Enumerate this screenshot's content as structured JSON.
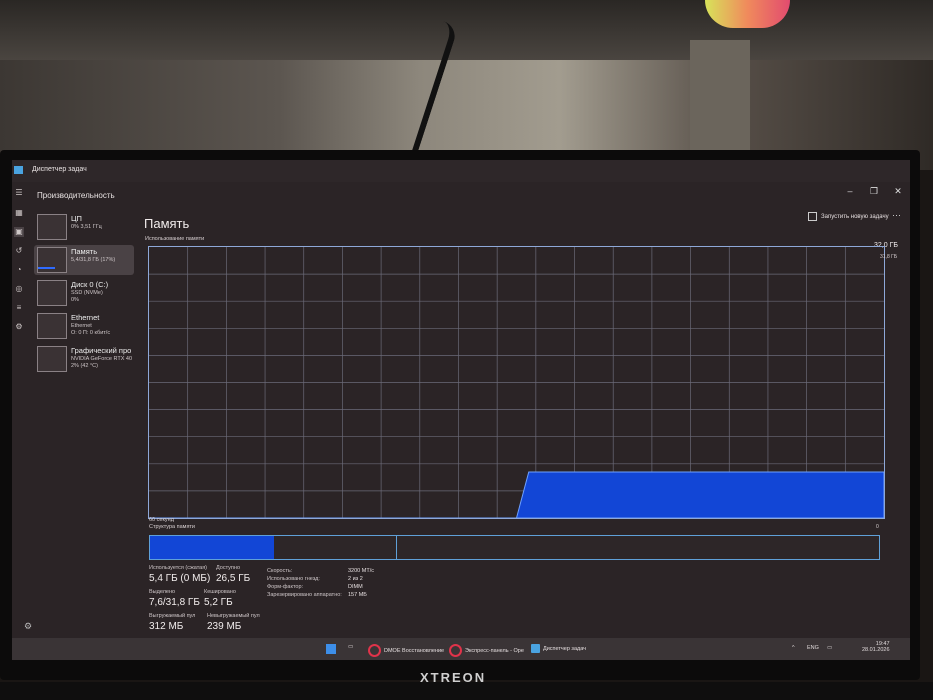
{
  "window": {
    "title": "Диспетчер задач",
    "section": "Производительность",
    "controls": [
      "–",
      "❐",
      "✕"
    ]
  },
  "sidebar": {
    "items": [
      {
        "name": "ЦП",
        "line2": "0% 3,51 ГГц",
        "line3": ""
      },
      {
        "name": "Память",
        "line2": "5,4/31,8 ГБ (17%)",
        "line3": ""
      },
      {
        "name": "Диск 0 (C:)",
        "line2": "SSD (NVMe)",
        "line3": "0%"
      },
      {
        "name": "Ethernet",
        "line2": "Ethernet",
        "line3": "О: 0 П: 0 кбит/с"
      },
      {
        "name": "Графический про",
        "line2": "NVIDIA GeForce RTX 40",
        "line3": "2% (42 °C)"
      }
    ]
  },
  "main": {
    "title": "Память",
    "run_task": "Запустить новую задачу",
    "more": "···",
    "usage_label": "Использование памяти",
    "total": "32,0 ГБ",
    "total_sub": "31,8 ГБ",
    "seconds_label": "60 секунд",
    "zero_label": "0",
    "structure_label": "Структура памяти"
  },
  "chart_data": {
    "type": "area",
    "title": "Использование памяти",
    "x_label": "60 секунд",
    "y_max_label": "31,8 ГБ",
    "ylim": [
      0,
      31.8
    ],
    "grid": true,
    "x": [
      0,
      30,
      31,
      60
    ],
    "values": [
      0,
      0,
      5.4,
      5.4
    ],
    "series_color": "#1246d6"
  },
  "structure": {
    "in_use_fraction": 0.17,
    "modified_fraction": 0.0,
    "standby_fraction": 0.167
  },
  "stats": {
    "in_use_label": "Используется (сжатая)",
    "in_use_value": "5,4 ГБ (0 МБ)",
    "available_label": "Доступно",
    "available_value": "26,5 ГБ",
    "committed_label": "Выделено",
    "committed_value": "7,6/31,8 ГБ",
    "cached_label": "Кешировано",
    "cached_value": "5,2 ГБ",
    "paged_label": "Выгружаемый пул",
    "paged_value": "312 МБ",
    "nonpaged_label": "Невыгружаемый пул",
    "nonpaged_value": "239 МБ"
  },
  "specs": {
    "labels": [
      "Скорость:",
      "Использовано гнезд:",
      "Форм-фактор:",
      "Зарезервировано аппаратно:"
    ],
    "values": [
      "3200 МТ/с",
      "2 из 2",
      "DIMM",
      "157 МБ"
    ]
  },
  "taskbar": {
    "items": [
      "DMOE Восстановление",
      "Экспресс-панель - Ope",
      "Диспетчер задач"
    ],
    "lang": "ENG",
    "time": "19:47",
    "date": "28.01.2026"
  },
  "monitor": {
    "brand": "XTREON"
  },
  "colors": {
    "accent": "#1246d6",
    "graph_border": "#8ea8d8"
  }
}
